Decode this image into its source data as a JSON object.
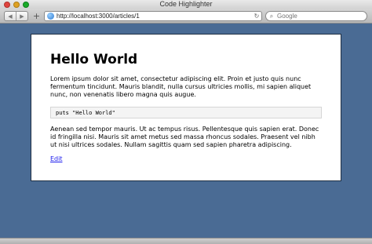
{
  "window": {
    "title": "Code Highlighter"
  },
  "toolbar": {
    "back_glyph": "◀",
    "forward_glyph": "▶",
    "new_tab_glyph": "+",
    "url": "http://localhost:3000/articles/1",
    "reload_glyph": "↻",
    "search_placeholder": "Google",
    "search_glyph": "⌕"
  },
  "article": {
    "title": "Hello World",
    "paragraph1": "Lorem ipsum dolor sit amet, consectetur adipiscing elit. Proin et justo quis nunc fermentum tincidunt. Mauris blandit, nulla cursus ultricies mollis, mi sapien aliquet nunc, non venenatis libero magna quis augue.",
    "code": "puts \"Hello World\"",
    "paragraph2": "Aenean sed tempor mauris. Ut ac tempus risus. Pellentesque quis sapien erat. Donec id fringilla nisi. Mauris sit amet metus sed massa rhoncus sodales. Praesent vel nibh ut nisi ultrices sodales. Nullam sagittis quam sed sapien pharetra adipiscing.",
    "edit_label": "Edit"
  },
  "colors": {
    "page_background": "#4a6b94",
    "link": "#1a1aee"
  },
  "icons": {
    "back": "back-arrow-icon",
    "forward": "forward-arrow-icon",
    "page": "globe-icon",
    "reload": "reload-icon",
    "search": "search-icon"
  }
}
